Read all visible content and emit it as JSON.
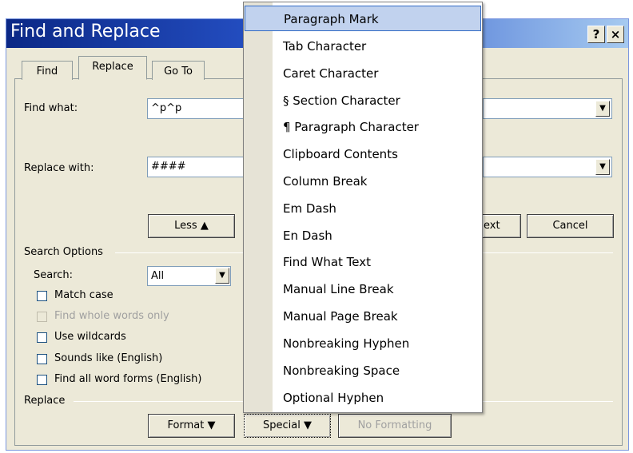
{
  "dialog": {
    "title": "Find and Replace",
    "help_button": "?",
    "close_button": "×"
  },
  "tabs": [
    {
      "label": "Find",
      "active": false
    },
    {
      "label": "Replace",
      "active": true
    },
    {
      "label": "Go To",
      "active": false
    }
  ],
  "find": {
    "label": "Find what:",
    "value": "^p^p"
  },
  "replace": {
    "label": "Replace with:",
    "value": "####"
  },
  "buttons": {
    "less": "Less ▲",
    "find_next_fragment": "ext",
    "cancel": "Cancel",
    "format": "Format ▼",
    "special": "Special ▼",
    "no_formatting": "No Formatting"
  },
  "search_options": {
    "header": "Search Options",
    "search_label": "Search:",
    "search_value": "All",
    "checkboxes": [
      {
        "label": "Match case",
        "checked": false,
        "enabled": true
      },
      {
        "label": "Find whole words only",
        "checked": false,
        "enabled": false
      },
      {
        "label": "Use wildcards",
        "checked": false,
        "enabled": true
      },
      {
        "label": "Sounds like (English)",
        "checked": false,
        "enabled": true
      },
      {
        "label": "Find all word forms (English)",
        "checked": false,
        "enabled": true
      }
    ]
  },
  "replace_section": {
    "header": "Replace"
  },
  "special_menu": {
    "items": [
      {
        "label": "Paragraph Mark",
        "selected": true
      },
      {
        "label": "Tab Character"
      },
      {
        "label": "Caret Character"
      },
      {
        "label": "§ Section Character"
      },
      {
        "label": "¶ Paragraph Character"
      },
      {
        "label": "Clipboard Contents"
      },
      {
        "label": "Column Break"
      },
      {
        "label": "Em Dash"
      },
      {
        "label": "En Dash"
      },
      {
        "label": "Find What Text"
      },
      {
        "label": "Manual Line Break"
      },
      {
        "label": "Manual Page Break"
      },
      {
        "label": "Nonbreaking Hyphen"
      },
      {
        "label": "Nonbreaking Space"
      },
      {
        "label": "Optional Hyphen"
      }
    ]
  },
  "colors": {
    "title_start": "#0b2886",
    "title_end": "#a6caf0",
    "face": "#ece9d8",
    "highlight": "#c1d2ee"
  }
}
